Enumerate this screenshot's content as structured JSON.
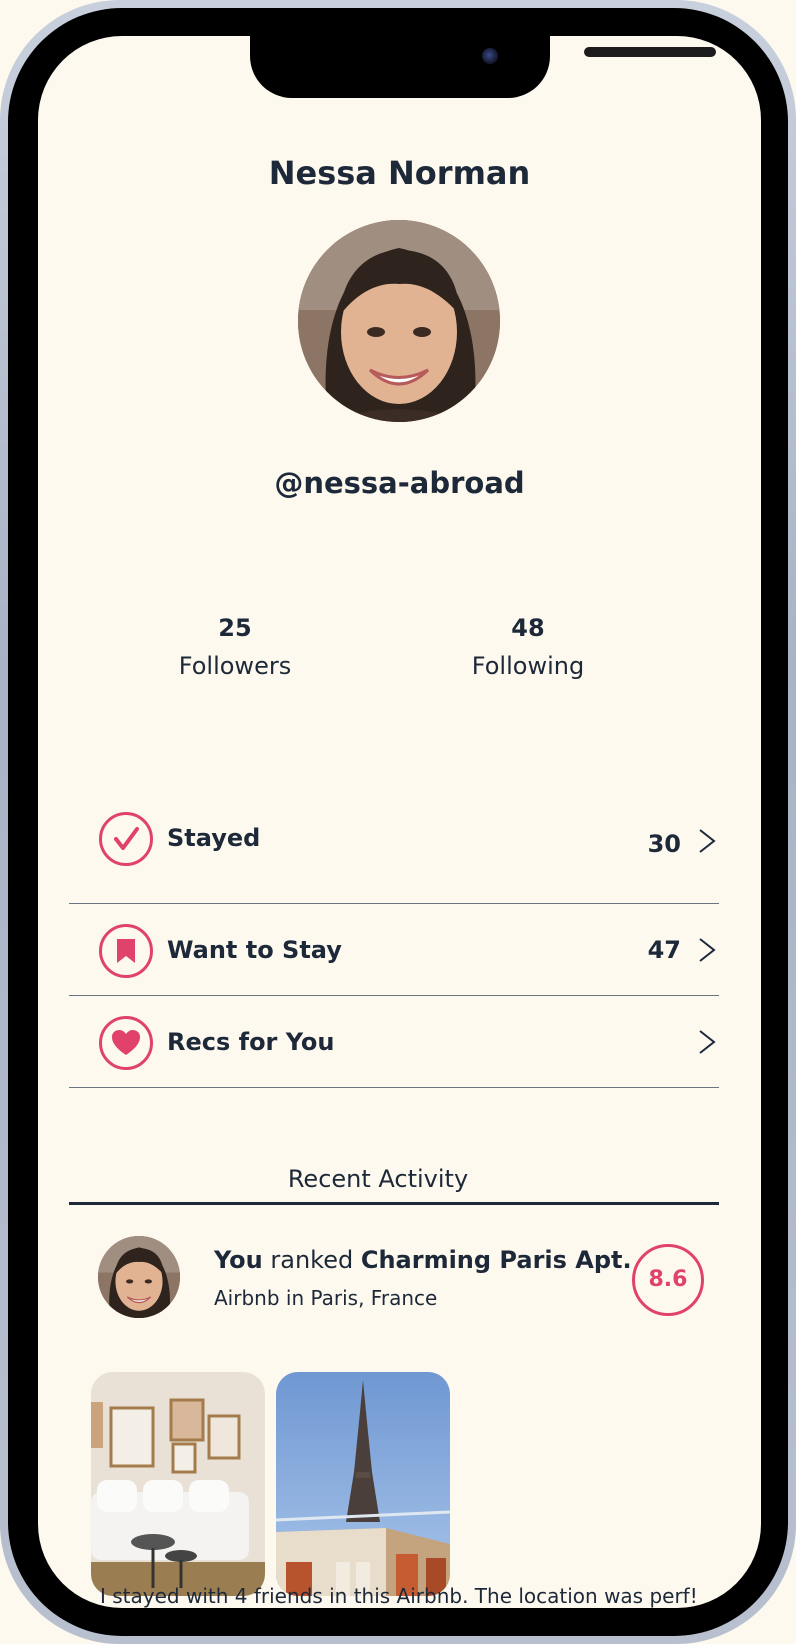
{
  "profile": {
    "name": "Nessa Norman",
    "handle": "@nessa-abroad",
    "followers_count": "25",
    "followers_label": "Followers",
    "following_count": "48",
    "following_label": "Following"
  },
  "lists": [
    {
      "label": "Stayed",
      "count": "30",
      "icon": "checkmark-icon"
    },
    {
      "label": "Want to Stay",
      "count": "47",
      "icon": "bookmark-icon"
    },
    {
      "label": "Recs for You",
      "count": "",
      "icon": "heart-icon"
    }
  ],
  "recent": {
    "title": "Recent Activity",
    "actor": "You",
    "verb": " ranked ",
    "place": "Charming Paris Apt.",
    "subtitle": "Airbnb in Paris, France",
    "score": "8.6",
    "review": "I stayed with 4 friends in this Airbnb. The location was perf!!"
  },
  "colors": {
    "accent": "#E0426B",
    "text": "#1D2939",
    "background": "#FDF9EF"
  }
}
